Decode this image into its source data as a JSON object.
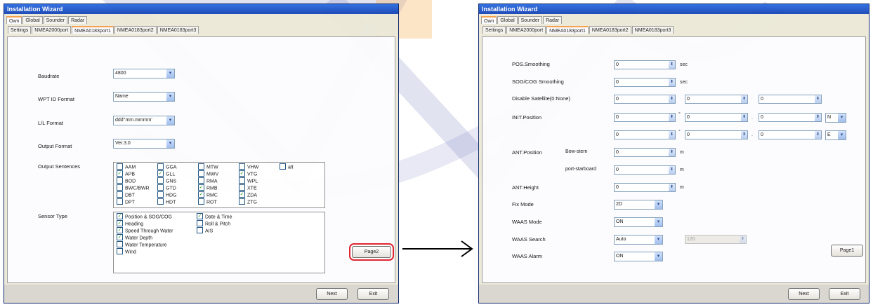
{
  "colors": {
    "titlebar": "#2f6ee0",
    "highlight_box": "#e0202a",
    "watermark_blue": "#5a64b4",
    "watermark_orange": "#f5b25e"
  },
  "left_window": {
    "title": "Installation Wizard",
    "tabs_top": [
      "Own",
      "Global",
      "Sounder",
      "Radar"
    ],
    "tabs_second": [
      "Settings",
      "NMEA2000port",
      "NMEA0183port1",
      "NMEA0183port2",
      "NMEA0183port3"
    ],
    "active_tab_second": "NMEA0183port1",
    "baudrate": {
      "label": "Baudrate",
      "value": "4800"
    },
    "wpt_id_format": {
      "label": "WPT ID Format",
      "value": "Name"
    },
    "ll_format": {
      "label": "L/L Format",
      "value": "ddd°mm.mmmm'"
    },
    "output_format": {
      "label": "Output Format",
      "value": "Ver.3.0"
    },
    "output_sentences": {
      "label": "Output Sentences",
      "items": [
        {
          "name": "AAM",
          "checked": false
        },
        {
          "name": "GGA",
          "checked": false
        },
        {
          "name": "MTW",
          "checked": false
        },
        {
          "name": "VHW",
          "checked": false
        },
        {
          "name": "alt",
          "checked": false
        },
        {
          "name": "APB",
          "checked": true
        },
        {
          "name": "GLL",
          "checked": true
        },
        {
          "name": "MWV",
          "checked": false
        },
        {
          "name": "VTG",
          "checked": true
        },
        {
          "name": "BOD",
          "checked": false
        },
        {
          "name": "GNS",
          "checked": false
        },
        {
          "name": "RMA",
          "checked": false
        },
        {
          "name": "WPL",
          "checked": false
        },
        {
          "name": "BWC/BWR",
          "checked": false
        },
        {
          "name": "GTD",
          "checked": false
        },
        {
          "name": "RMB",
          "checked": true
        },
        {
          "name": "XTE",
          "checked": false
        },
        {
          "name": "DBT",
          "checked": false
        },
        {
          "name": "HDG",
          "checked": false
        },
        {
          "name": "RMC",
          "checked": true
        },
        {
          "name": "ZDA",
          "checked": true
        },
        {
          "name": "DPT",
          "checked": false
        },
        {
          "name": "HDT",
          "checked": false
        },
        {
          "name": "ROT",
          "checked": false
        },
        {
          "name": "ZTG",
          "checked": false
        }
      ]
    },
    "sensor_type": {
      "label": "Sensor Type",
      "items": [
        {
          "name": "Position & SOG/COG",
          "checked": true
        },
        {
          "name": "Date & Time",
          "checked": true
        },
        {
          "name": "Heading",
          "checked": true
        },
        {
          "name": "Roll & Pitch",
          "checked": false
        },
        {
          "name": "Speed Through Water",
          "checked": true
        },
        {
          "name": "AIS",
          "checked": false
        },
        {
          "name": "Water Depth",
          "checked": true
        },
        {
          "name": "Water Temperature",
          "checked": false
        },
        {
          "name": "Wind",
          "checked": false
        }
      ]
    },
    "page_button": "Page2",
    "next_button": "Next",
    "exit_button": "Exit"
  },
  "right_window": {
    "title": "Installation Wizard",
    "tabs_top": [
      "Own",
      "Global",
      "Sounder",
      "Radar"
    ],
    "tabs_second": [
      "Settings",
      "NMEA2000port",
      "NMEA0183port1",
      "NMEA0183port2",
      "NMEA0183port3"
    ],
    "active_tab_second": "NMEA0183port1",
    "pos_smoothing": {
      "label": "POS.Smoothing",
      "value": "0",
      "unit": "sec"
    },
    "sog_cog_smoothing": {
      "label": "SOG/COG Smoothing",
      "value": "0",
      "unit": "sec"
    },
    "disable_satellite": {
      "label": "Disable Satellite(0:None)",
      "values": [
        "0",
        "0",
        "0"
      ]
    },
    "init_position": {
      "label": "INIT.Position",
      "lat": {
        "deg": "0",
        "min": "0",
        "frac": "0",
        "hemi": "N"
      },
      "lon": {
        "deg": "0",
        "min": "0",
        "frac": "0",
        "hemi": "E"
      },
      "deg_sym": "°",
      "dot_sym": "."
    },
    "ant_position": {
      "label": "ANT.Position",
      "bow_stern_label": "Bow-stern",
      "bow_stern_value": "0",
      "port_starboard_label": "port-starboard",
      "port_starboard_value": "0",
      "unit": "m"
    },
    "ant_height": {
      "label": "ANT.Height",
      "value": "0",
      "unit": "m"
    },
    "fix_mode": {
      "label": "Fix Mode",
      "value": "2D"
    },
    "waas_mode": {
      "label": "WAAS Mode",
      "value": "ON"
    },
    "waas_search": {
      "label": "WAAS Search",
      "value": "Auto",
      "channel": "120"
    },
    "waas_alarm": {
      "label": "WAAS Alarm",
      "value": "ON"
    },
    "page_button": "Page1",
    "next_button": "Next",
    "exit_button": "Exit"
  }
}
